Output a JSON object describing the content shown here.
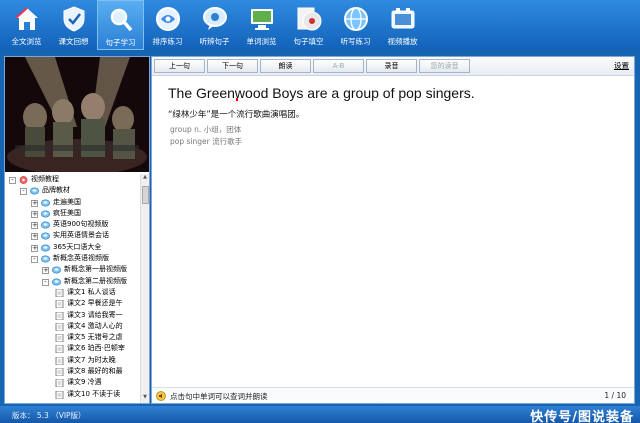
{
  "toolbar": {
    "items": [
      {
        "label": "全文浏览",
        "icon": "home-icon"
      },
      {
        "label": "课文回想",
        "icon": "shield-check-icon"
      },
      {
        "label": "句子学习",
        "icon": "magnifier-icon",
        "active": true
      },
      {
        "label": "排序练习",
        "icon": "clock-icon"
      },
      {
        "label": "听辨句子",
        "icon": "speech-bubble-icon"
      },
      {
        "label": "单词浏览",
        "icon": "monitor-icon"
      },
      {
        "label": "句子填空",
        "icon": "cd-icon"
      },
      {
        "label": "听写练习",
        "icon": "globe-icon"
      },
      {
        "label": "视频播放",
        "icon": "film-icon"
      }
    ]
  },
  "tree": {
    "rows": [
      {
        "label": "视频教程",
        "level": 0,
        "exp": "-",
        "icon": "root-icon"
      },
      {
        "label": "品牌教材",
        "level": 1,
        "exp": "-",
        "icon": "folder-icon"
      },
      {
        "label": "走遍美国",
        "level": 2,
        "exp": "+",
        "icon": "folder-icon"
      },
      {
        "label": "疯狂美国",
        "level": 2,
        "exp": "+",
        "icon": "folder-icon"
      },
      {
        "label": "英语900句视频版",
        "level": 2,
        "exp": "+",
        "icon": "folder-icon"
      },
      {
        "label": "实用英语情景会话",
        "level": 2,
        "exp": "+",
        "icon": "folder-icon"
      },
      {
        "label": "365天口语大全",
        "level": 2,
        "exp": "+",
        "icon": "folder-icon"
      },
      {
        "label": "新概念英语视频版",
        "level": 2,
        "exp": "-",
        "icon": "folder-icon"
      },
      {
        "label": "新概念第一册视频版",
        "level": 3,
        "exp": "+",
        "icon": "folder-icon"
      },
      {
        "label": "新概念第二册视频版",
        "level": 3,
        "exp": "-",
        "icon": "folder-icon"
      },
      {
        "label": "课文1 私人谈话",
        "level": 4,
        "exp": "",
        "icon": "doc-icon"
      },
      {
        "label": "课文2 早餐还是午",
        "level": 4,
        "exp": "",
        "icon": "doc-icon"
      },
      {
        "label": "课文3 请给我寄一",
        "level": 4,
        "exp": "",
        "icon": "doc-icon"
      },
      {
        "label": "课文4 激动人心的",
        "level": 4,
        "exp": "",
        "icon": "doc-icon"
      },
      {
        "label": "课文5 无错号之虐",
        "level": 4,
        "exp": "",
        "icon": "doc-icon"
      },
      {
        "label": "课文6 珀西·巴顿宰",
        "level": 4,
        "exp": "",
        "icon": "doc-icon"
      },
      {
        "label": "课文7 为时太晚",
        "level": 4,
        "exp": "",
        "icon": "doc-icon"
      },
      {
        "label": "课文8 最好的和最",
        "level": 4,
        "exp": "",
        "icon": "doc-icon"
      },
      {
        "label": "课文9 冷遇",
        "level": 4,
        "exp": "",
        "icon": "doc-icon"
      },
      {
        "label": "课文10 不读于读",
        "level": 4,
        "exp": "",
        "icon": "doc-icon"
      }
    ]
  },
  "player": {
    "buttons": [
      {
        "label": "上一句",
        "disabled": false
      },
      {
        "label": "下一句",
        "disabled": false
      },
      {
        "label": "朗读",
        "disabled": false
      },
      {
        "label": "A-B",
        "disabled": true
      },
      {
        "label": "录音",
        "disabled": false
      },
      {
        "label": "您的读音",
        "disabled": true
      }
    ],
    "settings_label": "设置"
  },
  "content": {
    "sentence": "The Greenwood Boys are a group of pop singers.",
    "translation": "“绿林少年”是一个流行歌曲演唱团。",
    "notes": [
      "group  n. 小组，团体",
      "pop singer  流行歌手"
    ]
  },
  "status": {
    "hint": "点击句中单词可以查词并朗读",
    "page": "1 / 10"
  },
  "bottom": {
    "version": "版本： 5.3    （VIP版）",
    "watermark": "快传号/图说装备"
  },
  "colors": {
    "toolbar": "#1f74cc",
    "accent": "#1565b3"
  }
}
